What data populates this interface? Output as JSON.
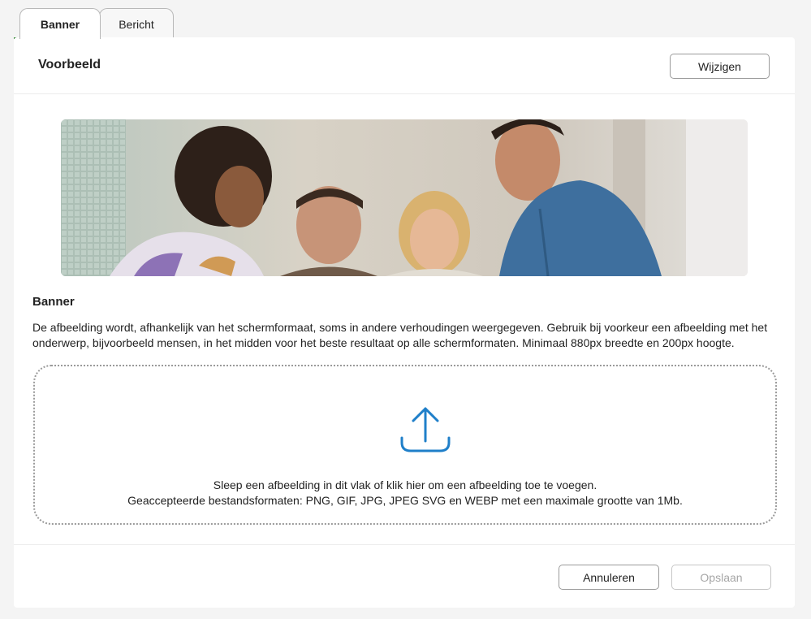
{
  "tabs": [
    {
      "label": "Banner",
      "active": true
    },
    {
      "label": "Bericht",
      "active": false
    }
  ],
  "preview": {
    "title": "Voorbeeld",
    "edit_label": "Wijzigen",
    "image_alt": "Vier lachende mensen in een lichte ruimte"
  },
  "banner_section": {
    "title": "Banner",
    "description": "De afbeelding wordt, afhankelijk van het schermformaat, soms in andere verhoudingen weergegeven. Gebruik bij voorkeur een afbeelding met het onderwerp, bijvoorbeeld mensen, in het midden voor het beste resultaat op alle schermformaten. Minimaal 880px breedte en 200px hoogte."
  },
  "dropzone": {
    "line1": "Sleep een afbeelding in dit vlak of klik hier om een afbeelding toe te voegen.",
    "line2": "Geaccepteerde bestandsformaten: PNG, GIF, JPG, JPEG SVG en WEBP met een maximale grootte van 1Mb.",
    "icon": "upload-icon"
  },
  "footer": {
    "cancel_label": "Annuleren",
    "save_label": "Opslaan"
  },
  "colors": {
    "tab_underline": "#3a8c3a",
    "upload_icon": "#1f7fc9",
    "disabled_text": "#a6a6a6"
  }
}
